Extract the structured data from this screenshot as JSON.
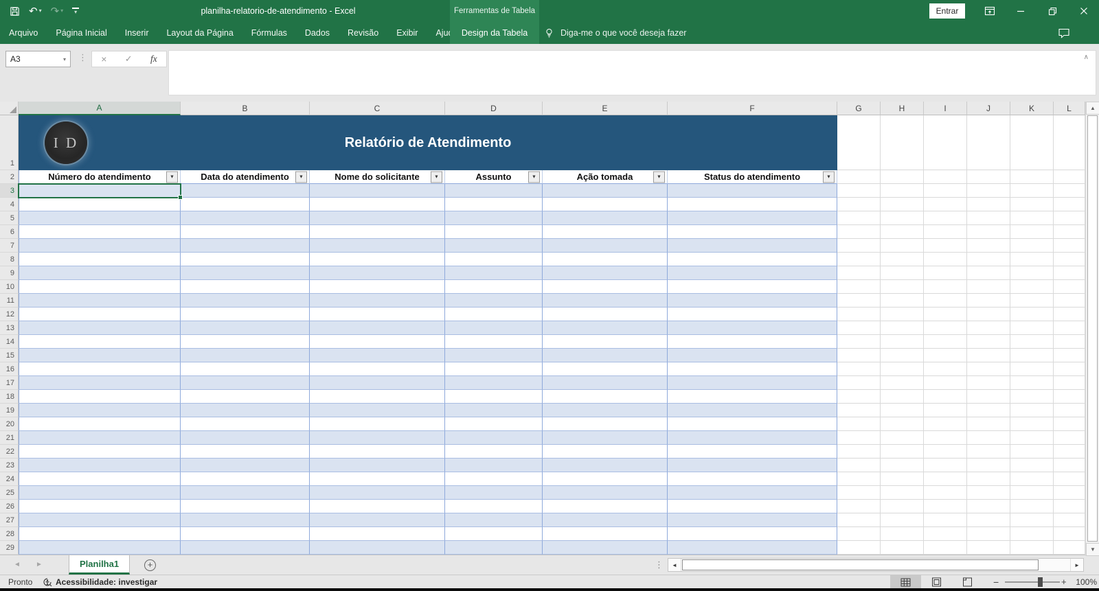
{
  "titlebar": {
    "title": "planilha-relatorio-de-atendimento - Excel",
    "contextual_title": "Ferramentas de Tabela",
    "signin": "Entrar"
  },
  "ribbon": {
    "tabs": [
      "Arquivo",
      "Página Inicial",
      "Inserir",
      "Layout da Página",
      "Fórmulas",
      "Dados",
      "Revisão",
      "Exibir",
      "Ajuda"
    ],
    "contextual_tab": "Design da Tabela",
    "tellme": "Diga-me o que você deseja fazer"
  },
  "formula_bar": {
    "cell_reference": "A3",
    "formula": ""
  },
  "sheet": {
    "columns": [
      "A",
      "B",
      "C",
      "D",
      "E",
      "F",
      "G",
      "H",
      "I",
      "J",
      "K",
      "L"
    ],
    "rows": [
      "1",
      "2",
      "3",
      "4",
      "5",
      "6",
      "7",
      "8",
      "9",
      "10",
      "11",
      "12",
      "13",
      "14",
      "15",
      "16",
      "17",
      "18",
      "19",
      "20",
      "21",
      "22",
      "23",
      "24",
      "25",
      "26",
      "27",
      "28",
      "29"
    ],
    "active_column": "A",
    "active_row": "3",
    "active_cell": "A3"
  },
  "table": {
    "title": "Relatório de Atendimento",
    "logo_text": "I D",
    "headers": [
      "Número do atendimento",
      "Data do atendimento",
      "Nome do solicitante",
      "Assunto",
      "Ação tomada",
      "Status do atendimento"
    ]
  },
  "sheet_tabs": {
    "active_tab": "Planilha1"
  },
  "status_bar": {
    "mode": "Pronto",
    "accessibility": "Acessibilidade: investigar",
    "zoom_level": "100%"
  },
  "icons": {
    "undo": "↶",
    "redo": "↷",
    "caret": "▾",
    "separator_dots": "⋮",
    "cancel": "×",
    "confirm": "✓",
    "insert_function": "fx",
    "collapse_formula_bar": "∧",
    "filter_dropdown": "▼",
    "scroll_up": "▲",
    "scroll_down": "▼",
    "scroll_left": "◄",
    "scroll_right": "►",
    "sheet_prev": "◄",
    "sheet_next": "►",
    "add_sheet": "+",
    "zoom_out": "−",
    "zoom_in": "+"
  },
  "colors": {
    "excel_green": "#217346",
    "contextual_green": "#2E8555",
    "banner_blue": "#25567C",
    "band_blue": "#DAE3F1",
    "table_border": "#8EA9DB"
  }
}
